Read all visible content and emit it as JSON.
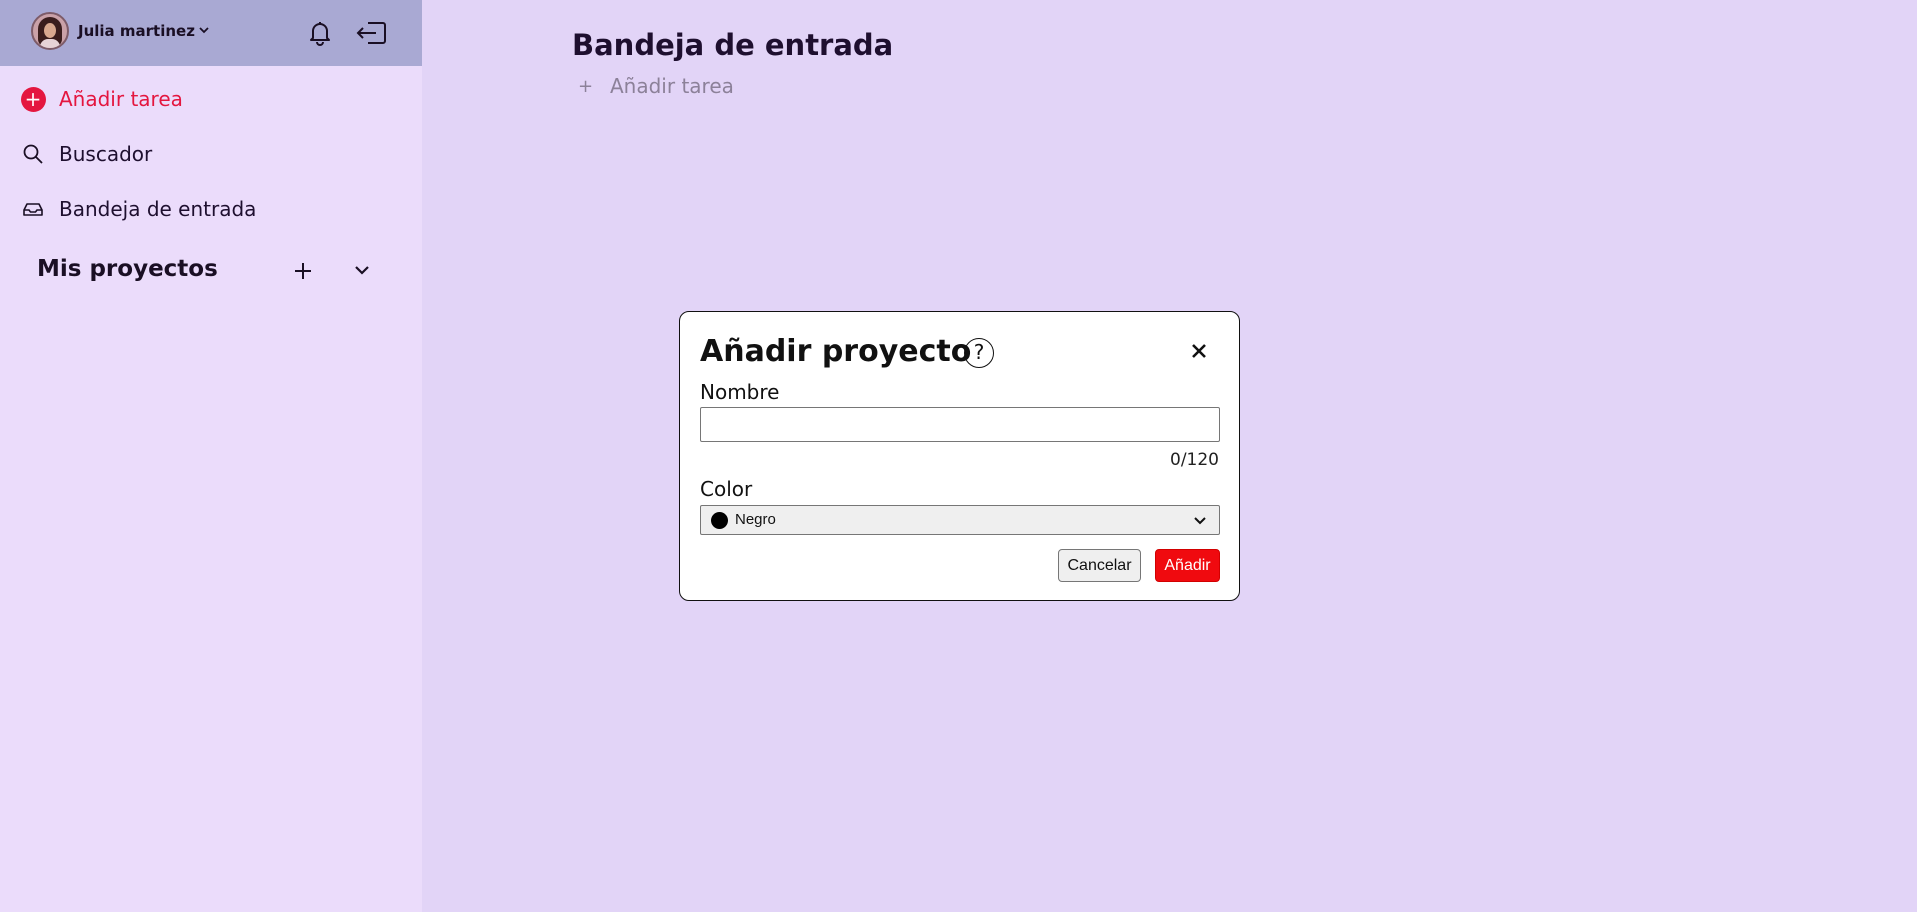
{
  "user": {
    "name": "Julia martinez"
  },
  "sidebar": {
    "items": [
      {
        "label": "Añadir tarea",
        "icon": "add-circle-icon"
      },
      {
        "label": "Buscador",
        "icon": "search-icon"
      },
      {
        "label": "Bandeja de entrada",
        "icon": "inbox-icon"
      }
    ],
    "projects_heading": "Mis proyectos"
  },
  "main": {
    "title": "Bandeja de entrada",
    "add_task_label": "Añadir tarea"
  },
  "modal": {
    "title": "Añadir proyecto",
    "help_glyph": "?",
    "name_label": "Nombre",
    "name_value": "",
    "char_count": "0/120",
    "color_label": "Color",
    "color_value": "Negro",
    "color_swatch": "#000000",
    "cancel_label": "Cancelar",
    "confirm_label": "Añadir"
  },
  "colors": {
    "accent": "#e4163f",
    "confirm": "#f00a0f",
    "sidebar_bg": "#ebdcfb",
    "main_bg": "#e2d4f7",
    "topbar_bg": "#a9a9d3"
  }
}
